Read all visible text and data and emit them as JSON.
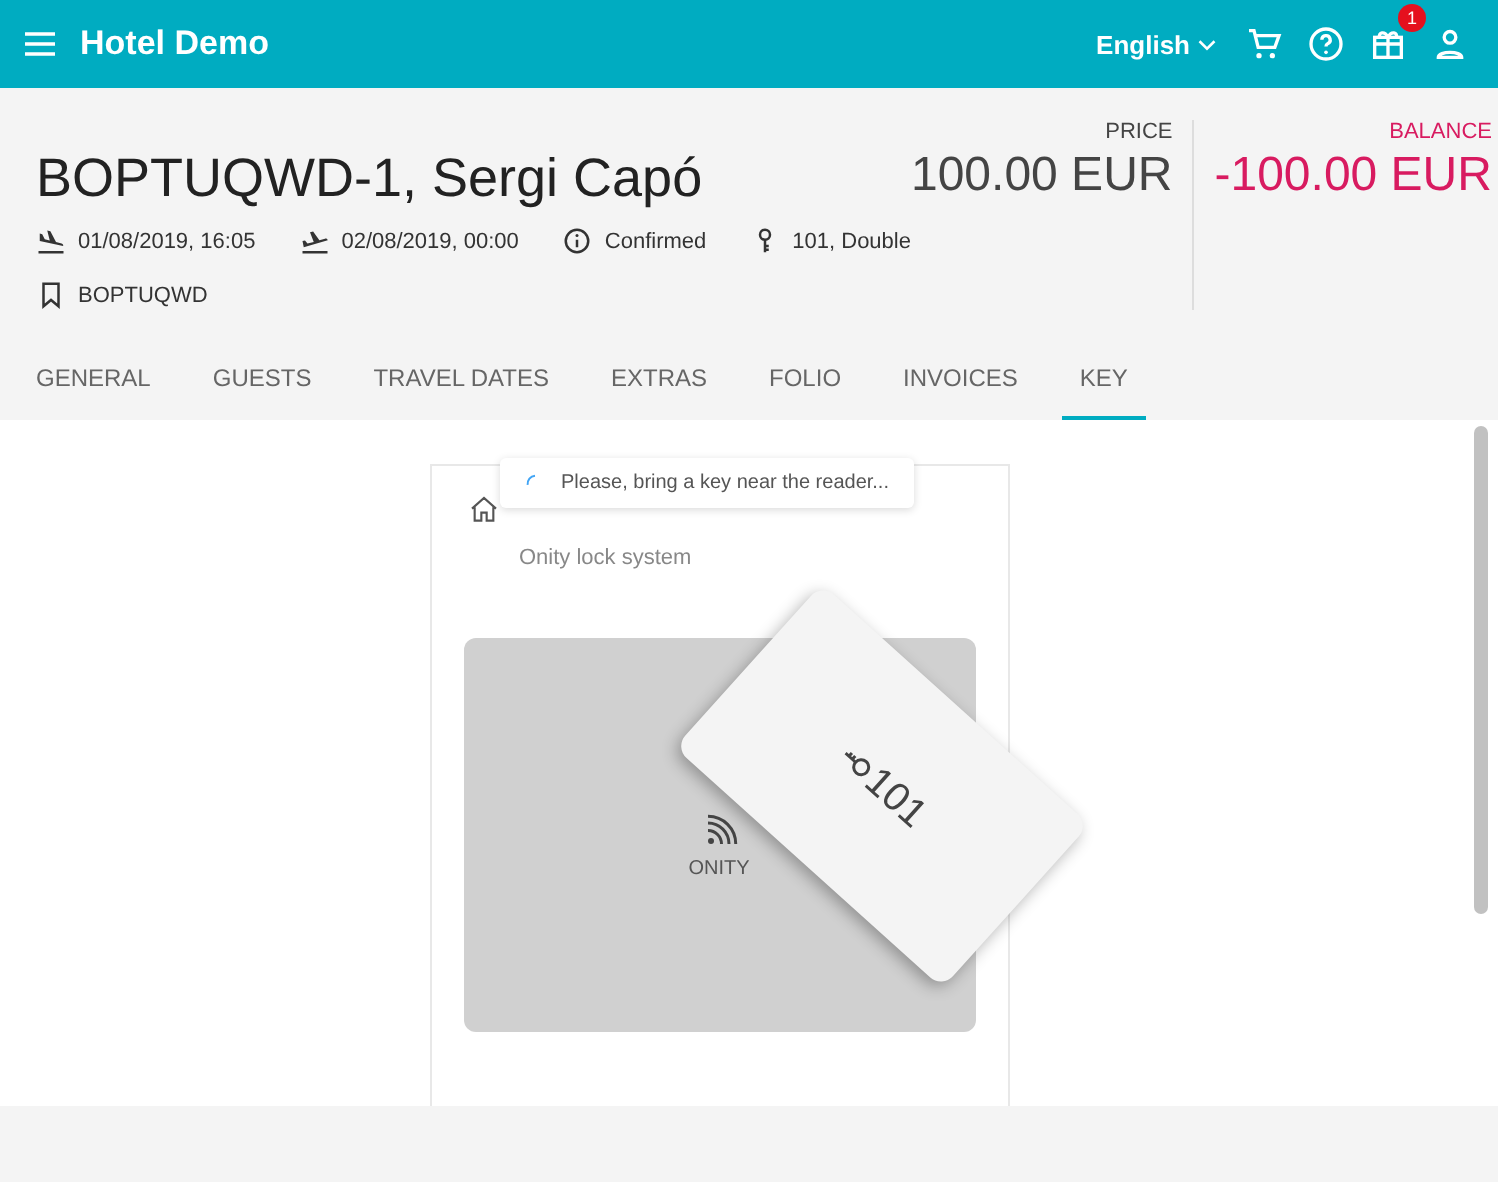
{
  "app_bar": {
    "title": "Hotel Demo",
    "language": "English",
    "notification_count": "1"
  },
  "booking": {
    "title": "BOPTUQWD-1, Sergi Capó",
    "price_label": "PRICE",
    "price": "100.00 EUR",
    "balance_label": "BALANCE",
    "balance": "-100.00 EUR",
    "details": [
      {
        "kind": "arrival",
        "text": "01/08/2019, 16:05"
      },
      {
        "kind": "departure",
        "text": "02/08/2019, 00:00"
      },
      {
        "kind": "status",
        "text": "Confirmed"
      },
      {
        "kind": "room",
        "text": "101, Double"
      }
    ],
    "reference": "BOPTUQWD"
  },
  "tabs": [
    {
      "label": "GENERAL",
      "selected": false
    },
    {
      "label": "GUESTS",
      "selected": false
    },
    {
      "label": "TRAVEL DATES",
      "selected": false
    },
    {
      "label": "EXTRAS",
      "selected": false
    },
    {
      "label": "FOLIO",
      "selected": false
    },
    {
      "label": "INVOICES",
      "selected": false
    },
    {
      "label": "KEY",
      "selected": true
    }
  ],
  "key_panel": {
    "subtitle": "Onity lock system",
    "reader_label": "ONITY",
    "key_card": "101"
  },
  "toast": {
    "message": "Please, bring a key near the reader..."
  }
}
